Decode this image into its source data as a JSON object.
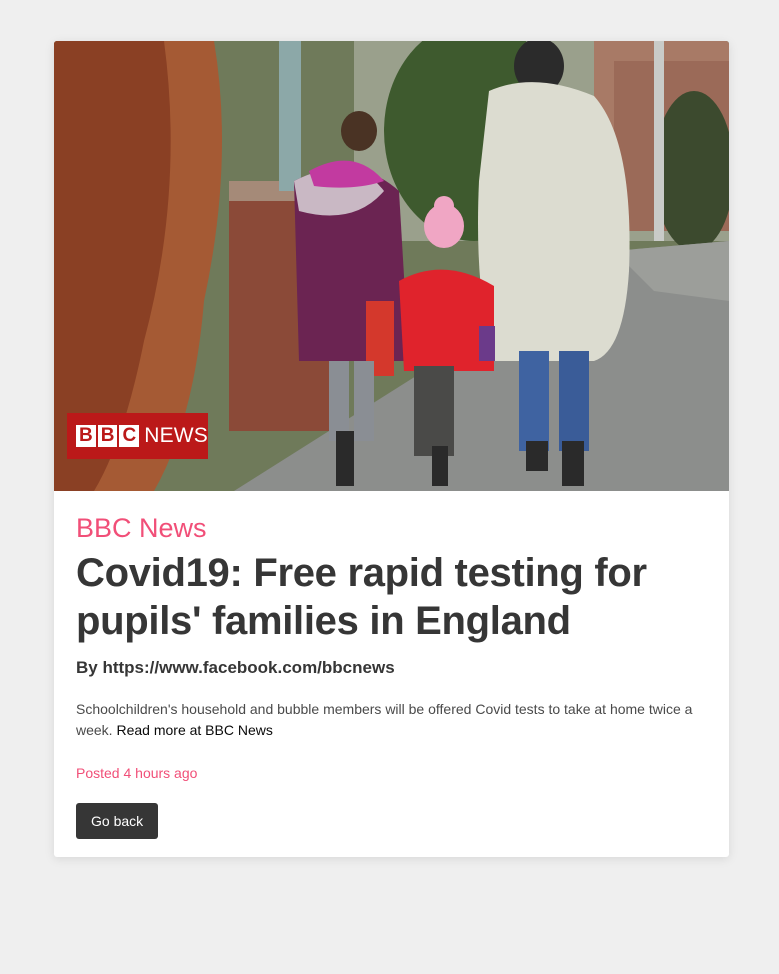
{
  "article": {
    "logo_letters": [
      "B",
      "B",
      "C"
    ],
    "logo_word": "NEWS",
    "source": "BBC News",
    "title": "Covid19: Free rapid testing for pupils' families in England",
    "author": "By https://www.facebook.com/bbcnews",
    "description": "Schoolchildren's household and bubble members will be offered Covid tests to take at home twice a week.",
    "read_more": "Read more at BBC News",
    "posted": "Posted 4 hours ago",
    "back_label": "Go back"
  },
  "colors": {
    "accent": "#f14f78",
    "text_dark": "#363636",
    "background": "#efefef",
    "logo_red": "#bb1919"
  }
}
